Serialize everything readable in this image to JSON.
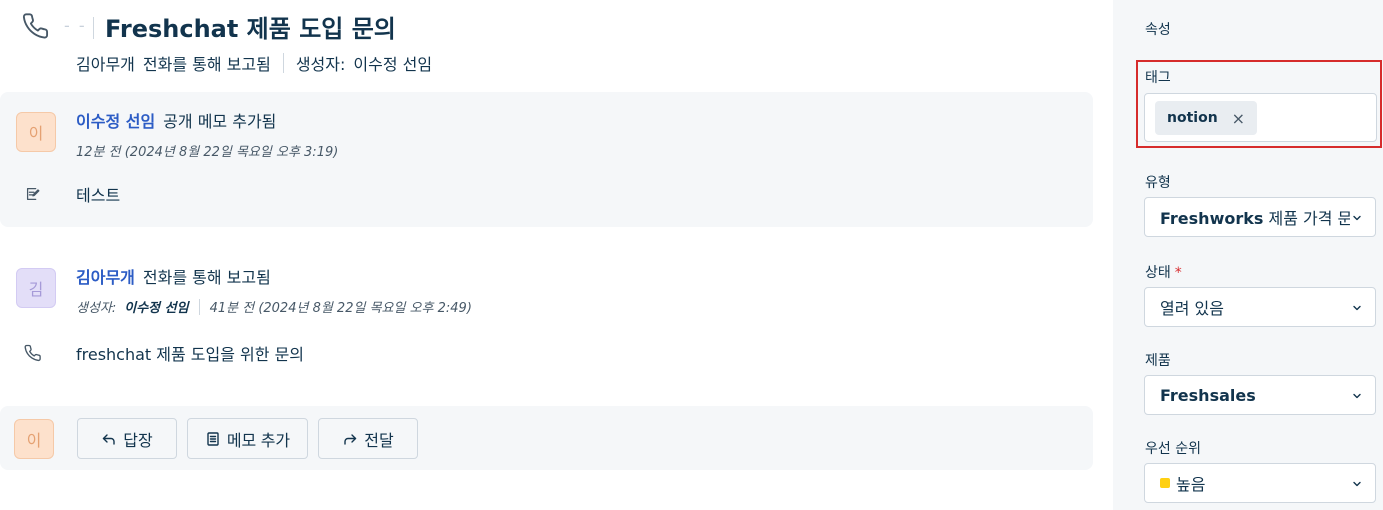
{
  "header": {
    "dash": "- -",
    "title": "Freshchat 제품 도입 문의",
    "requester": "김아무개",
    "channel_text": "전화를 통해 보고됨",
    "created_by_label": "생성자:",
    "created_by": "이수정 선임"
  },
  "conversations": [
    {
      "avatar_initial": "이",
      "author": "이수정 선임",
      "action": "공개 메모 추가됨",
      "time": "12분 전 (2024년 8월 22일 목요일 오후 3:19)",
      "body": "테스트"
    },
    {
      "avatar_initial": "김",
      "author": "김아무개",
      "action": "전화를 통해 보고됨",
      "created_by_label": "생성자:",
      "created_by": "이수정 선임",
      "time": "41분 전 (2024년 8월 22일 목요일 오후 2:49)",
      "body": "freshchat 제품 도입을 위한 문의"
    }
  ],
  "reply_bar": {
    "avatar_initial": "이",
    "reply_label": "답장",
    "note_label": "메모 추가",
    "forward_label": "전달"
  },
  "properties": {
    "heading": "속성",
    "tags_label": "태그",
    "tags": [
      "notion"
    ],
    "type_label": "유형",
    "type_value": "Freshworks 제품 가격 문",
    "status_label": "상태",
    "status_required_mark": "*",
    "status_value": "열려 있음",
    "product_label": "제품",
    "product_value": "Freshsales",
    "priority_label": "우선 순위",
    "priority_value": "높음",
    "priority_color": "#ffd012"
  },
  "colors": {
    "link": "#2c5cc5",
    "highlight_outline": "#d62c2c"
  }
}
